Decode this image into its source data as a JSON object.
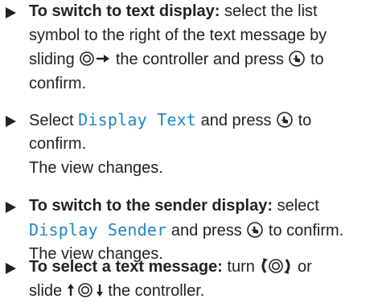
{
  "instructions": [
    {
      "lines": [
        {
          "bold": "To switch to text display:",
          "text": " select the list"
        },
        {
          "text": "symbol to the right of the text message by"
        },
        {
          "pre": "sliding ",
          "post": " the controller and press ",
          "tail": " to"
        },
        {
          "text": "confirm."
        }
      ],
      "icons": [
        "controller-slide-right-icon",
        "controller-press-icon"
      ]
    },
    {
      "lines": [
        {
          "pre": "Select ",
          "code": "Display Text",
          "post": " and press ",
          "tail": " to"
        },
        {
          "text": "confirm."
        }
      ],
      "result": "The view changes.",
      "icons": [
        "controller-press-icon"
      ]
    },
    {
      "lines": [
        {
          "bold": "To switch to the sender display:",
          "text": " select"
        },
        {
          "code": "Display Sender",
          "post": " and press ",
          "tail": " to confirm."
        }
      ],
      "result": "The view changes.",
      "icons": [
        "controller-press-icon"
      ]
    },
    {
      "lines": [
        {
          "bold": "To select a text message:",
          "pre": " turn ",
          "tail": " or"
        },
        {
          "pre": "slide ",
          "post": " the controller."
        }
      ],
      "icons": [
        "controller-turn-icon",
        "controller-slide-updown-icon"
      ]
    }
  ],
  "colors": {
    "text": "#222222",
    "code": "#1f86c8"
  }
}
